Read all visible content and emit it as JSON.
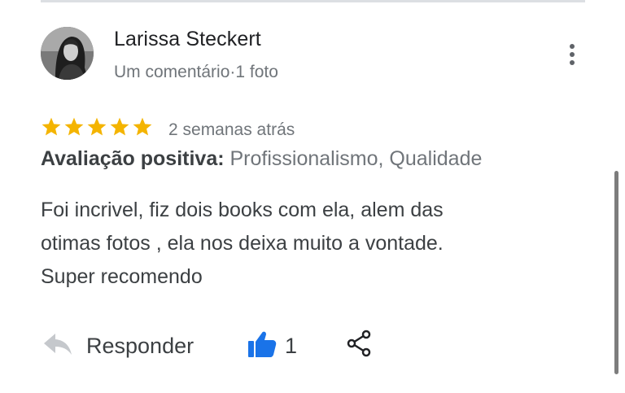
{
  "review": {
    "reviewer_name": "Larissa Steckert",
    "reviewer_meta": "Um comentário·1 foto",
    "rating": 5,
    "rating_max": 5,
    "date": "2 semanas atrás",
    "attributes_label": "Avaliação positiva:",
    "attributes_values": " Profissionalismo, Qualidade",
    "text_lines": [
      "Foi incrivel, fiz dois books com ela, alem das",
      "otimas fotos , ela nos deixa muito a vontade.",
      "Super recomendo"
    ]
  },
  "actions": {
    "reply_label": "Responder",
    "like_count": "1"
  },
  "icons": {
    "avatar": "avatar-photo",
    "more": "more-vertical-icon",
    "star": "star-icon",
    "reply": "reply-arrow-icon",
    "like": "thumbs-up-icon",
    "share": "share-icon"
  },
  "colors": {
    "star": "#f4b400",
    "like": "#1a73e8",
    "reply_icon": "#c5c8cc",
    "name": "#202124",
    "secondary_text": "#70757a"
  }
}
